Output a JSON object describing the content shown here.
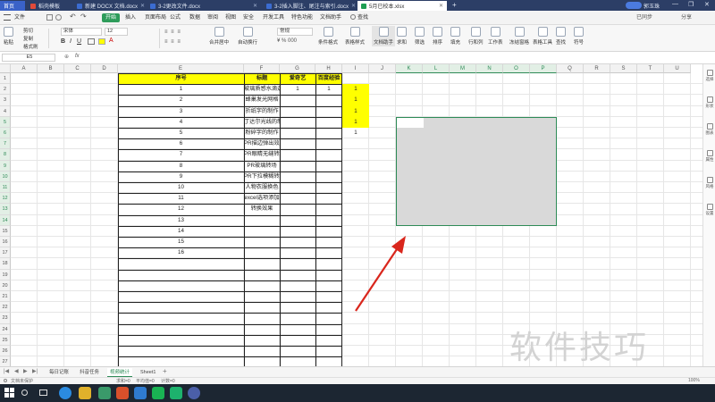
{
  "tabs": [
    {
      "label": "首页",
      "icon_color": "#3a62c8"
    },
    {
      "label": "稻壳模板",
      "icon_color": "#e04a3a"
    },
    {
      "label": "新建 DOCX 文档.docx",
      "icon_color": "#3b6cd1"
    },
    {
      "label": "3-2更改文件.docx",
      "icon_color": "#3b6cd1"
    },
    {
      "label": "3-2插入脚注、尾注与索引.docx",
      "icon_color": "#3b6cd1"
    },
    {
      "label": "5月已校本.xlsx",
      "icon_color": "#1e9e52"
    }
  ],
  "window_buttons": {
    "user": "郭玉珠",
    "sync": "已同步",
    "share": "分享"
  },
  "menu": [
    "文件",
    "开始",
    "插入",
    "页面布局",
    "公式",
    "数据",
    "审阅",
    "视图",
    "安全",
    "开发工具",
    "特色功能",
    "文档助手",
    "查找"
  ],
  "ribbon": {
    "paste": "粘贴",
    "cut": "剪切",
    "copy": "复制",
    "format_painter": "格式刷",
    "font_name": "宋体",
    "font_size": "12",
    "merge": "合并居中",
    "wrap": "自动换行",
    "number_format": "常规",
    "conditional": "条件格式",
    "table_style": "表格样式",
    "doc_assistant": "文档助手",
    "sum": "求和",
    "filter": "筛选",
    "sort": "排序",
    "fill": "填充",
    "rowcol": "行和列",
    "sheet": "工作表",
    "freeze": "冻结窗格",
    "table_tools": "表格工具",
    "find": "查找",
    "symbol": "符号"
  },
  "formula_bar": {
    "name_box": "E5",
    "fx": "fx",
    "value": ""
  },
  "columns": [
    "A",
    "B",
    "C",
    "D",
    "E",
    "F",
    "G",
    "H",
    "I",
    "J",
    "K",
    "L",
    "M",
    "N",
    "O",
    "P",
    "Q",
    "R",
    "S",
    "T",
    "U"
  ],
  "selected_columns": [
    "K",
    "L",
    "M",
    "N",
    "O",
    "P"
  ],
  "rows": [
    "1",
    "2",
    "3",
    "4",
    "5",
    "6",
    "7",
    "8",
    "9",
    "10",
    "11",
    "12",
    "13",
    "14",
    "15",
    "16",
    "17",
    "18",
    "19",
    "20",
    "21",
    "22",
    "23",
    "24",
    "25",
    "26",
    "27"
  ],
  "selected_rows": [
    "5",
    "6",
    "7",
    "8",
    "9",
    "10",
    "11",
    "12",
    "13",
    "14"
  ],
  "table": {
    "headers": {
      "seq": "序号",
      "title": "标题",
      "aiqiyi": "爱奇艺",
      "baidu": "百度经验"
    },
    "rows": [
      {
        "seq": "1",
        "title": "玻璃质感水滴透明按钮制作",
        "aiqiyi": "1",
        "baidu": "1"
      },
      {
        "seq": "2",
        "title": "蜂巢发光网格",
        "aiqiyi": "",
        "baidu": ""
      },
      {
        "seq": "3",
        "title": "折纸字的制作",
        "aiqiyi": "",
        "baidu": ""
      },
      {
        "seq": "4",
        "title": "丁达尔光线的制作",
        "aiqiyi": "",
        "baidu": ""
      },
      {
        "seq": "5",
        "title": "粉碎字的制作",
        "aiqiyi": "",
        "baidu": ""
      },
      {
        "seq": "6",
        "title": "PR描边弹出效果",
        "aiqiyi": "",
        "baidu": ""
      },
      {
        "seq": "7",
        "title": "PR眼睛无缝转场",
        "aiqiyi": "",
        "baidu": ""
      },
      {
        "seq": "8",
        "title": "PR玻璃转场",
        "aiqiyi": "",
        "baidu": ""
      },
      {
        "seq": "9",
        "title": "PR下拉模糊转场",
        "aiqiyi": "",
        "baidu": ""
      },
      {
        "seq": "10",
        "title": "人物衣服换色",
        "aiqiyi": "",
        "baidu": ""
      },
      {
        "seq": "11",
        "title": "excel选项添加",
        "aiqiyi": "",
        "baidu": ""
      },
      {
        "seq": "12",
        "title": "转换效果",
        "aiqiyi": "",
        "baidu": ""
      },
      {
        "seq": "13",
        "title": "",
        "aiqiyi": "",
        "baidu": ""
      },
      {
        "seq": "14",
        "title": "",
        "aiqiyi": "",
        "baidu": ""
      },
      {
        "seq": "15",
        "title": "",
        "aiqiyi": "",
        "baidu": ""
      },
      {
        "seq": "16",
        "title": "",
        "aiqiyi": "",
        "baidu": ""
      }
    ]
  },
  "column_i_values": [
    "1",
    "1",
    "1",
    "1",
    "1"
  ],
  "sheet_tabs": [
    "每日记账",
    "抖音任务",
    "视频统计",
    "Sheet1"
  ],
  "active_sheet": "视频统计",
  "status": {
    "left": "文档未保护",
    "sum": "求和=0",
    "avg": "平均值=0",
    "count": "计数=0",
    "zoom": "100%"
  },
  "right_panel": [
    "选择",
    "形状",
    "图表",
    "属性",
    "风格",
    "设置"
  ],
  "watermark": "软件技巧",
  "colors": {
    "accent_green": "#2e8b57",
    "header_yellow": "#ffff00",
    "selection_gray": "#d9d9d9",
    "arrow_red": "#d9261c"
  }
}
